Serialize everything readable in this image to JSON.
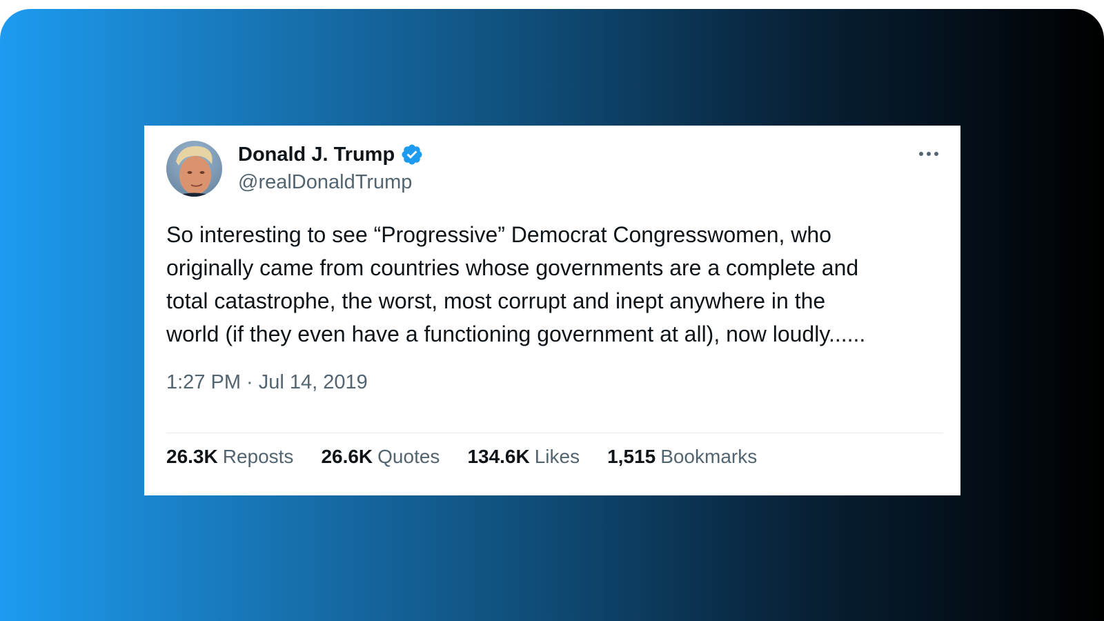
{
  "tweet": {
    "author": {
      "name": "Donald J. Trump",
      "handle": "@realDonaldTrump",
      "verified": true
    },
    "text_lines": [
      "So interesting to see “Progressive” Democrat Congresswomen, who",
      "originally came from countries whose governments are a complete and",
      "total catastrophe, the worst, most corrupt and inept anywhere in the",
      "world (if they even have a functioning government at all), now loudly......"
    ],
    "timestamp": "1:27 PM · Jul 14, 2019",
    "stats": [
      {
        "value": "26.3K",
        "label": "Reposts"
      },
      {
        "value": "26.6K",
        "label": "Quotes"
      },
      {
        "value": "134.6K",
        "label": "Likes"
      },
      {
        "value": "1,515",
        "label": "Bookmarks"
      }
    ]
  },
  "icons": {
    "more": "more-horizontal-icon",
    "verified": "verified-badge-icon"
  },
  "colors": {
    "background_gradient_start": "#1d9bf0",
    "background_gradient_end": "#000000",
    "card_background": "#ffffff",
    "primary_text": "#0f1419",
    "secondary_text": "#536471",
    "verified_badge": "#1d9bf0"
  }
}
